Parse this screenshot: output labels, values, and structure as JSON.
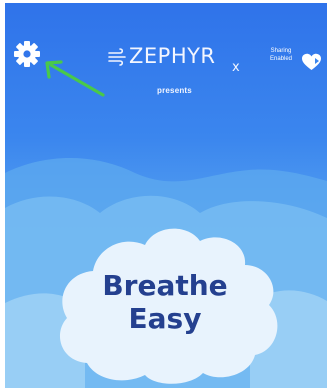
{
  "brand": {
    "name": "ZEPHYR",
    "suffix": "x",
    "tagline": "presents",
    "mark_icon": "wind-icon"
  },
  "settings": {
    "icon": "gear-icon",
    "pointer_icon": "arrow-icon",
    "pointer_color": "#49c94a"
  },
  "sharing": {
    "line1": "Sharing",
    "line2": "Enabled",
    "icon": "heart-share-icon"
  },
  "hero": {
    "line1": "Breathe",
    "line2": "Easy",
    "text_color": "#24408f"
  },
  "colors": {
    "background_top": "#2f73ea",
    "background_bottom": "#7fc0f4",
    "cloud": "#e8f3fd"
  }
}
